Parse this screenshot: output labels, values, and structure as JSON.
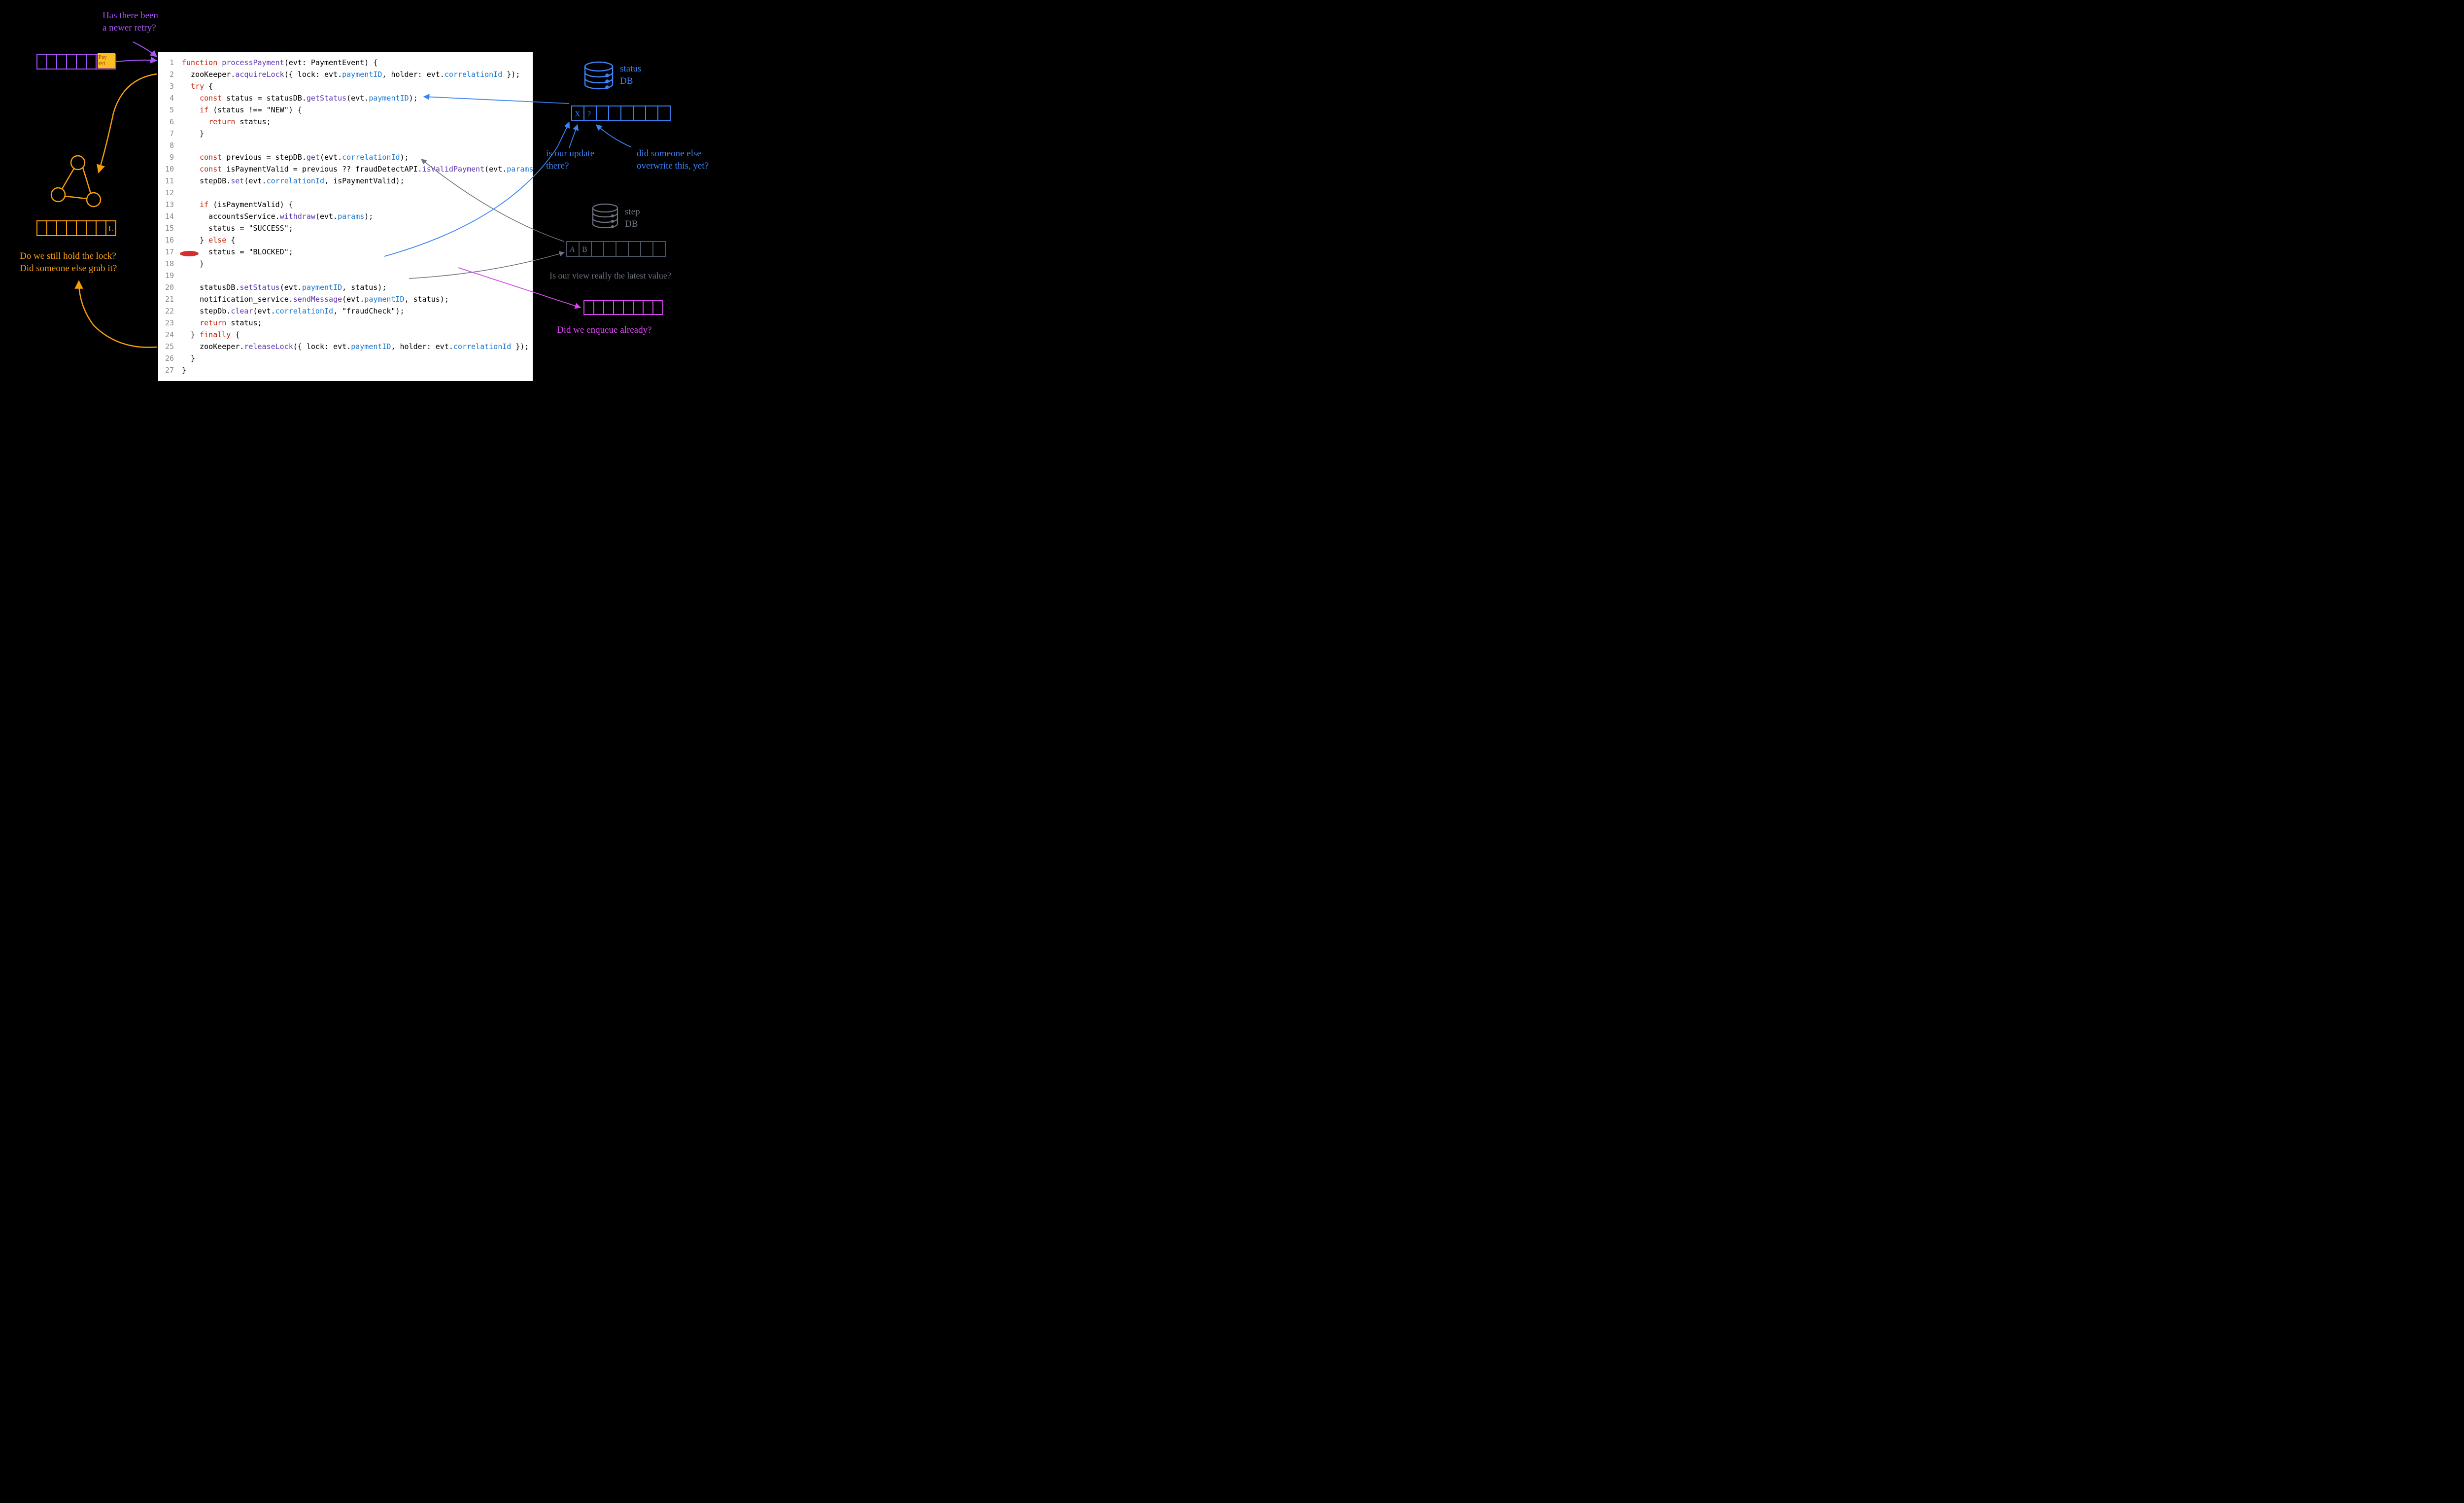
{
  "annotations": {
    "top_question": "Has there been\na newer retry?",
    "lock_question": "Do we still hold the lock?\nDid someone else grab it?",
    "status_db_label": "status\nDB",
    "status_q1": "is our update\nthere?",
    "status_q2": "did someone else\noverwrite this, yet?",
    "step_db_label": "step\nDB",
    "step_q": "Is our view really the latest value?",
    "enqueue_q": "Did we enqueue already?",
    "sticky": "Pay\nevt",
    "status_cell_x": "X",
    "status_cell_q": "?",
    "step_cell_a": "A",
    "step_cell_b": "B",
    "lock_cell": "L"
  },
  "code": [
    {
      "n": 1,
      "html": "<span class='kw'>function</span> <span class='fn'>processPayment</span>(evt: PaymentEvent) {"
    },
    {
      "n": 2,
      "html": "  zooKeeper.<span class='fn'>acquireLock</span>({ lock: evt.<span class='prop'>paymentID</span>, holder: evt.<span class='prop'>correlationId</span> });"
    },
    {
      "n": 3,
      "html": "  <span class='kw'>try</span> {"
    },
    {
      "n": 4,
      "html": "    <span class='kw'>const</span> status = statusDB.<span class='fn'>getStatus</span>(evt.<span class='prop'>paymentID</span>);"
    },
    {
      "n": 5,
      "html": "    <span class='kw'>if</span> (status !== <span class='str'>\"NEW\"</span>) {"
    },
    {
      "n": 6,
      "html": "      <span class='kw'>return</span> status;"
    },
    {
      "n": 7,
      "html": "    }"
    },
    {
      "n": 8,
      "html": ""
    },
    {
      "n": 9,
      "html": "    <span class='kw'>const</span> previous = stepDB.<span class='fn'>get</span>(evt.<span class='prop'>correlationId</span>);"
    },
    {
      "n": 10,
      "html": "    <span class='kw'>const</span> isPaymentValid = previous ?? fraudDetectAPI.<span class='fn'>isValidPayment</span>(evt.<span class='prop'>params</span>));"
    },
    {
      "n": 11,
      "html": "    stepDB.<span class='fn'>set</span>(evt.<span class='prop'>correlationId</span>, isPaymentValid);"
    },
    {
      "n": 12,
      "html": ""
    },
    {
      "n": 13,
      "html": "    <span class='kw'>if</span> (isPaymentValid) {"
    },
    {
      "n": 14,
      "html": "      accountsService.<span class='fn'>withdraw</span>(evt.<span class='prop'>params</span>);"
    },
    {
      "n": 15,
      "html": "      status = <span class='str'>\"SUCCESS\"</span>;"
    },
    {
      "n": 16,
      "html": "    } <span class='kw'>else</span> {"
    },
    {
      "n": 17,
      "html": "      status = <span class='str'>\"BLOCKED\"</span>;"
    },
    {
      "n": 18,
      "html": "    }"
    },
    {
      "n": 19,
      "html": ""
    },
    {
      "n": 20,
      "html": "    statusDB.<span class='fn'>setStatus</span>(evt.<span class='prop'>paymentID</span>, status);"
    },
    {
      "n": 21,
      "html": "    notification_service.<span class='fn'>sendMessage</span>(evt.<span class='prop'>paymentID</span>, status);"
    },
    {
      "n": 22,
      "html": "    stepDb.<span class='fn'>clear</span>(evt.<span class='prop'>correlationId</span>, <span class='str'>\"fraudCheck\"</span>);"
    },
    {
      "n": 23,
      "html": "    <span class='kw'>return</span> status;"
    },
    {
      "n": 24,
      "html": "  } <span class='kw'>finally</span> {"
    },
    {
      "n": 25,
      "html": "    zooKeeper.<span class='fn'>releaseLock</span>({ lock: evt.<span class='prop'>paymentID</span>, holder: evt.<span class='prop'>correlationId</span> });"
    },
    {
      "n": 26,
      "html": "  }"
    },
    {
      "n": 27,
      "html": "}"
    }
  ]
}
